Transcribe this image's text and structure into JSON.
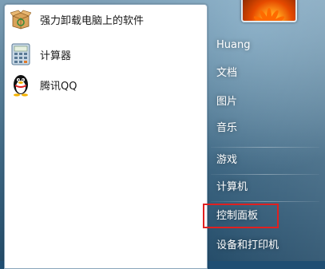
{
  "programs": [
    {
      "label": "强力卸载电脑上的软件",
      "icon": "uninstaller-box-icon"
    },
    {
      "label": "计算器",
      "icon": "calculator-icon"
    },
    {
      "label": "腾讯QQ",
      "icon": "qq-penguin-icon"
    }
  ],
  "right_menu": {
    "user": "Huang",
    "documents": "文档",
    "pictures": "图片",
    "music": "音乐",
    "games": "游戏",
    "computer": "计算机",
    "control_panel": "控制面板",
    "devices_printers": "设备和打印机"
  },
  "colors": {
    "highlight": "#e02020",
    "pane_top": "#7d9fb6",
    "pane_bottom": "#234b68"
  }
}
